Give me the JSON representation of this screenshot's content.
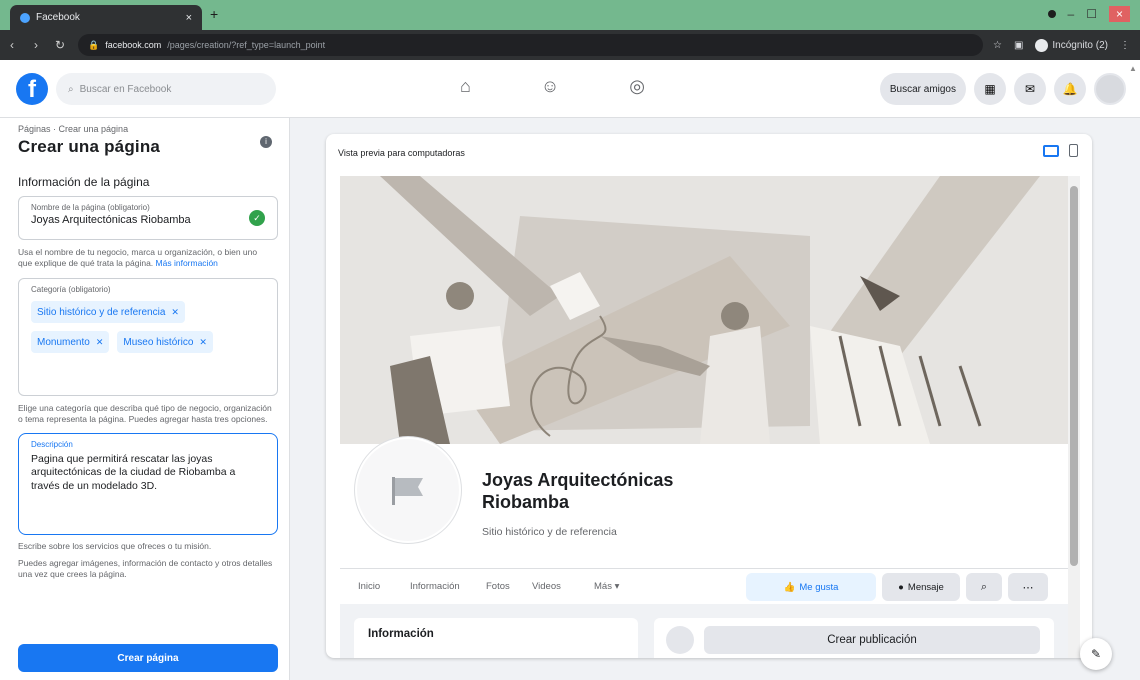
{
  "browser": {
    "tab_title": "Facebook",
    "tab_close": "×",
    "new_tab": "+",
    "url_host": "facebook.com",
    "url_path": "/pages/creation/?ref_type=launch_point",
    "incognito_label": "Incógnito (2)",
    "win_minimize": "–",
    "win_maximize": "☐",
    "win_close": "×"
  },
  "fbnav": {
    "logo": "f",
    "search_placeholder": "Buscar en Facebook",
    "find_friends": "Buscar amigos"
  },
  "left": {
    "breadcrumb": "Páginas · Crear una página",
    "title": "Crear una página",
    "section_title": "Información de la página",
    "name_label": "Nombre de la página (obligatorio)",
    "name_value": "Joyas Arquitectónicas Riobamba",
    "name_help": "Usa el nombre de tu negocio, marca u organización, o bien uno que explique de qué trata la página.",
    "name_help_link": "Más información",
    "cat_label": "Categoría (obligatorio)",
    "categories": [
      "Sitio histórico y de referencia",
      "Monumento",
      "Museo histórico"
    ],
    "cat_help": "Elige una categoría que describa qué tipo de negocio, organización o tema representa la página. Puedes agregar hasta tres opciones.",
    "desc_label": "Descripción",
    "desc_value": "Pagina que permitirá rescatar las joyas arquitectónicas de la ciudad de Riobamba a través de un modelado 3D.",
    "desc_help": "Escribe sobre los servicios que ofreces o tu misión.",
    "bottom_help": "Puedes agregar imágenes, información de contacto y otros detalles una vez que crees la página.",
    "create_button": "Crear página"
  },
  "preview": {
    "header": "Vista previa para computadoras",
    "page_name_line1": "Joyas Arquitectónicas",
    "page_name_line2": "Riobamba",
    "page_category": "Sitio histórico y de referencia",
    "tabs": [
      "Inicio",
      "Información",
      "Fotos",
      "Videos",
      "Más ▾"
    ],
    "like_button": "Me gusta",
    "message_button": "Mensaje",
    "info_card_title": "Información",
    "create_post": "Crear publicación"
  },
  "colors": {
    "facebook_blue": "#1877f2",
    "browser_frame": "#74b88e",
    "success_green": "#31a24c"
  }
}
